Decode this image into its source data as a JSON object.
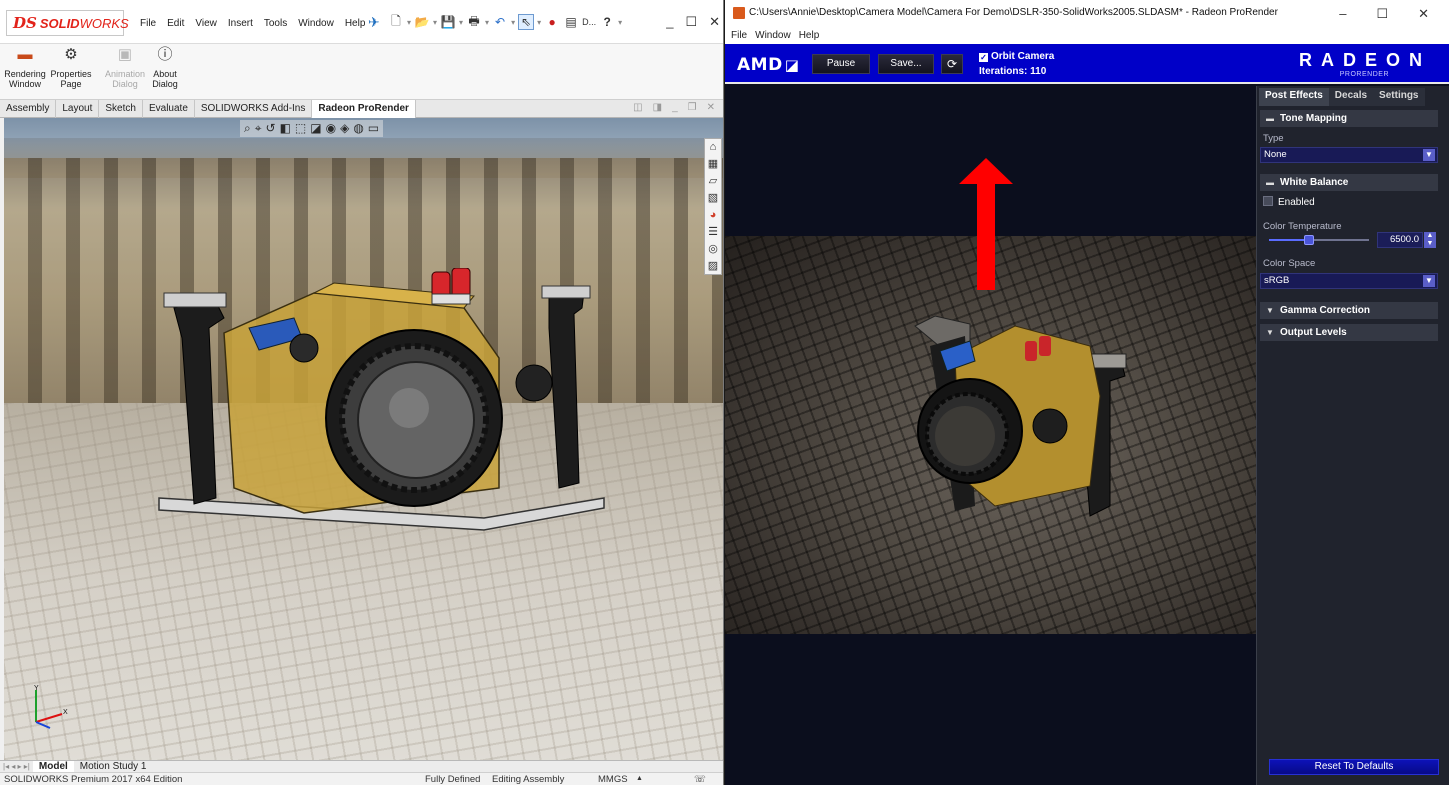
{
  "solidworks": {
    "logo_ds": "DS",
    "logo_solid": "SOLID",
    "logo_works": "WORKS",
    "menu": [
      "File",
      "Edit",
      "View",
      "Insert",
      "Tools",
      "Window",
      "Help"
    ],
    "doc_short": "D...",
    "help_glyph": "?",
    "ribbon": [
      {
        "label": "Rendering Window",
        "icon": "rendering-window-icon",
        "enabled": true
      },
      {
        "label": "Properties Page",
        "icon": "gear-icon",
        "enabled": true
      },
      {
        "label": "Animation Dialog",
        "icon": "animation-icon",
        "enabled": false
      },
      {
        "label": "About Dialog",
        "icon": "info-icon",
        "enabled": true
      }
    ],
    "tabs": [
      "Assembly",
      "Layout",
      "Sketch",
      "Evaluate",
      "SOLIDWORKS Add-Ins",
      "Radeon ProRender"
    ],
    "active_tab": "Radeon ProRender",
    "bottom_tabs": [
      "Model",
      "Motion Study 1"
    ],
    "status": {
      "edition": "SOLIDWORKS Premium 2017 x64 Edition",
      "defined": "Fully Defined",
      "mode": "Editing Assembly",
      "units": "MMGS",
      "units_arrow": "▲"
    },
    "triad": {
      "x": "X",
      "y": "Y"
    }
  },
  "prorender": {
    "title": "C:\\Users\\Annie\\Desktop\\Camera Model\\Camera For Demo\\DSLR-350-SolidWorks2005.SLDASM* - Radeon ProRender",
    "menu": [
      "File",
      "Window",
      "Help"
    ],
    "amd_logo": "AMD",
    "amd_mark": "◪",
    "pause_label": "Pause",
    "save_label": "Save...",
    "orbit_camera_label": "Orbit Camera",
    "orbit_camera_checked": true,
    "iterations_label": "Iterations: 110",
    "radeon_logo": "RADEON",
    "prorender_sub": "PRORENDER",
    "panel": {
      "tabs": [
        "Post Effects",
        "Decals",
        "Settings"
      ],
      "active_tab": "Post Effects",
      "tone_mapping": {
        "title": "Tone Mapping",
        "type_label": "Type",
        "type_value": "None"
      },
      "white_balance": {
        "title": "White Balance",
        "enabled_label": "Enabled",
        "color_temp_label": "Color Temperature",
        "color_temp_value": "6500.0",
        "color_temp_slider_fraction": 0.4,
        "color_space_label": "Color Space",
        "color_space_value": "sRGB"
      },
      "gamma_correction": "Gamma Correction",
      "output_levels": "Output Levels",
      "reset_label": "Reset To Defaults"
    }
  },
  "colors": {
    "amd_toolbar": "#0000c8",
    "annotation_arrow": "#ff0000",
    "solidworks_red": "#e2231a"
  }
}
